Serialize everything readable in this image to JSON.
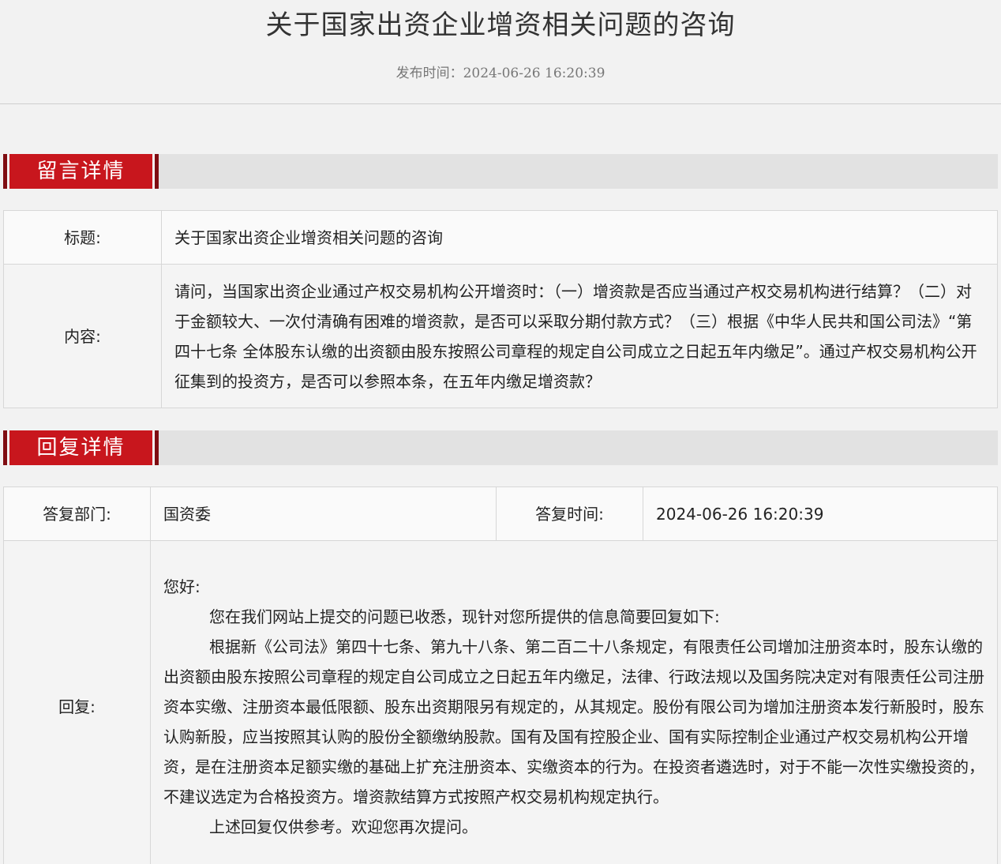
{
  "header": {
    "title": "关于国家出资企业增资相关问题的咨询",
    "publish_label": "发布时间：",
    "publish_time": "2024-06-26 16:20:39"
  },
  "message_section": {
    "heading": "留言详情",
    "title_label": "标题:",
    "title_value": "关于国家出资企业增资相关问题的咨询",
    "content_label": "内容:",
    "content_value": "请问，当国家出资企业通过产权交易机构公开增资时：（一）增资款是否应当通过产权交易机构进行结算？（二）对于金额较大、一次付清确有困难的增资款，是否可以采取分期付款方式？（三）根据《中华人民共和国公司法》“第四十七条 全体股东认缴的出资额由股东按照公司章程的规定自公司成立之日起五年内缴足”。通过产权交易机构公开征集到的投资方，是否可以参照本条，在五年内缴足增资款？"
  },
  "reply_section": {
    "heading": "回复详情",
    "dept_label": "答复部门:",
    "dept_value": "国资委",
    "time_label": "答复时间:",
    "time_value": "2024-06-26 16:20:39",
    "reply_label": "回复:",
    "reply_paragraphs": [
      "您好:",
      "您在我们网站上提交的问题已收悉，现针对您所提供的信息简要回复如下:",
      "根据新《公司法》第四十七条、第九十八条、第二百二十八条规定，有限责任公司增加注册资本时，股东认缴的出资额由股东按照公司章程的规定自公司成立之日起五年内缴足，法律、行政法规以及国务院决定对有限责任公司注册资本实缴、注册资本最低限额、股东出资期限另有规定的，从其规定。股份有限公司为增加注册资本发行新股时，股东认购新股，应当按照其认购的股份全额缴纳股款。国有及国有控股企业、国有实际控制企业通过产权交易机构公开增资，是在注册资本足额实缴的基础上扩充注册资本、实缴资本的行为。在投资者遴选时，对于不能一次性实缴投资的，不建议选定为合格投资方。增资款结算方式按照产权交易机构规定执行。",
      "上述回复仅供参考。欢迎您再次提问。"
    ]
  }
}
